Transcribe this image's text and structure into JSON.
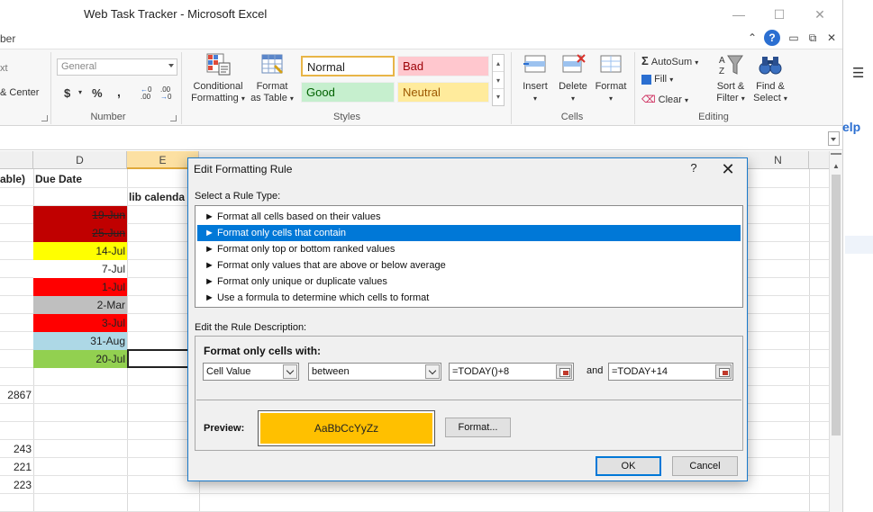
{
  "window": {
    "title": "Web Task Tracker  -  Microsoft Excel",
    "menu_fragment": "ber",
    "right_pane_text": "elp"
  },
  "ribbon": {
    "alignment_fragment": "xt",
    "merge_center_fragment": "& Center",
    "number_format": "General",
    "currency": "$",
    "percent": "%",
    "comma": ",",
    "increase_decimal": ".00",
    "decrease_decimal": ".00",
    "groups": {
      "number": "Number",
      "styles": "Styles",
      "cells": "Cells",
      "editing": "Editing"
    },
    "conditional_formatting": {
      "line1": "Conditional",
      "line2": "Formatting"
    },
    "format_as_table": {
      "line1": "Format",
      "line2": "as Table"
    },
    "styles": {
      "normal": "Normal",
      "bad": "Bad",
      "good": "Good",
      "neutral": "Neutral"
    },
    "cells": {
      "insert": "Insert",
      "delete": "Delete",
      "format": "Format"
    },
    "editing": {
      "autosum": "AutoSum",
      "fill": "Fill",
      "clear": "Clear",
      "sort_filter": {
        "line1": "Sort &",
        "line2": "Filter"
      },
      "find_select": {
        "line1": "Find &",
        "line2": "Select"
      }
    }
  },
  "sheet": {
    "columns": [
      "D",
      "E",
      "N"
    ],
    "header_fragment": "able)",
    "header_due_date": "Due Date",
    "e2_text": "lib calenda",
    "due_dates": [
      {
        "value": "19-Jun",
        "bg": "#c00000",
        "strike": true
      },
      {
        "value": "25-Jun",
        "bg": "#c00000",
        "strike": true
      },
      {
        "value": "14-Jul",
        "bg": "#ffff00",
        "strike": false
      },
      {
        "value": "7-Jul",
        "bg": "#ffffff",
        "strike": false
      },
      {
        "value": "1-Jul",
        "bg": "#ff0000",
        "strike": false
      },
      {
        "value": "2-Mar",
        "bg": "#bfbfbf",
        "strike": false
      },
      {
        "value": "3-Jul",
        "bg": "#ff0000",
        "strike": false
      },
      {
        "value": "31-Aug",
        "bg": "#add8e6",
        "strike": false
      },
      {
        "value": "20-Jul",
        "bg": "#92d050",
        "strike": false
      }
    ],
    "left_values": [
      "2867",
      "243",
      "221",
      "223"
    ]
  },
  "dialog": {
    "title": "Edit Formatting Rule",
    "help": "?",
    "close": "✕",
    "select_rule_type_label": "Select a Rule Type:",
    "rule_types": [
      "► Format all cells based on their values",
      "► Format only cells that contain",
      "► Format only top or bottom ranked values",
      "► Format only values that are above or below average",
      "► Format only unique or duplicate values",
      "► Use a formula to determine which cells to format"
    ],
    "selected_rule_index": 1,
    "edit_desc_label": "Edit the Rule Description:",
    "format_only_cells_with": "Format only cells with:",
    "condition_subject": "Cell Value",
    "condition_operator": "between",
    "value1": "=TODAY()+8",
    "and_label": "and",
    "value2": "=TODAY+14",
    "preview_label": "Preview:",
    "preview_sample": "AaBbCcYyZz",
    "preview_fill": "#ffc000",
    "format_button": "Format...",
    "ok_button": "OK",
    "cancel_button": "Cancel"
  }
}
